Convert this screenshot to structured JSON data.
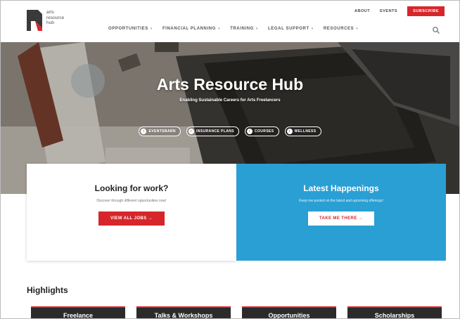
{
  "brand": {
    "logo_line1": "arts",
    "logo_line2": "resource",
    "logo_line3": "hub",
    "accent": "#d7262b",
    "blue": "#2a9fd4"
  },
  "util_nav": {
    "about": "ABOUT",
    "events": "EVENTS",
    "subscribe": "SUBSCRIBE"
  },
  "main_nav": [
    {
      "label": "OPPORTUNITIES"
    },
    {
      "label": "FINANCIAL PLANNING"
    },
    {
      "label": "TRAINING"
    },
    {
      "label": "LEGAL SUPPORT"
    },
    {
      "label": "RESOURCES"
    }
  ],
  "hero": {
    "title": "Arts Resource Hub",
    "subtitle": "Enabling Sustainable Careers for Arts Freelancers",
    "pills": [
      {
        "label": "EVENTSBARN"
      },
      {
        "label": "INSURANCE PLANS"
      },
      {
        "label": "COURSES"
      },
      {
        "label": "WELLNESS"
      }
    ]
  },
  "card_work": {
    "title": "Looking for work?",
    "desc": "Discover through different opportunities now!",
    "button": "VIEW ALL JOBS →"
  },
  "card_news": {
    "title": "Latest Happenings",
    "desc": "Keep me posted on the latest and upcoming offerings!",
    "button": "TAKE ME THERE →"
  },
  "highlights": {
    "title": "Highlights",
    "tiles": [
      {
        "label": "Freelance"
      },
      {
        "label": "Talks & Workshops"
      },
      {
        "label": "Opportunities"
      },
      {
        "label": "Scholarships"
      }
    ]
  }
}
